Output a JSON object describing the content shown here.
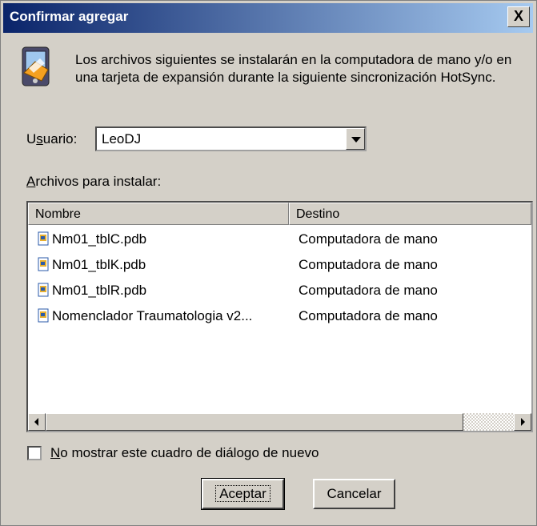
{
  "window": {
    "title": "Confirmar agregar",
    "close_glyph": "X"
  },
  "message": "Los archivos siguientes se instalarán en la computadora de mano y/o en una tarjeta de expansión durante la siguiente sincronización HotSync.",
  "user": {
    "label_prefix": "U",
    "label_accel": "s",
    "label_suffix": "uario:",
    "value": "LeoDJ"
  },
  "files_label": {
    "accel": "A",
    "rest": "rchivos para instalar:"
  },
  "list": {
    "columns": [
      "Nombre",
      "Destino"
    ],
    "rows": [
      {
        "name": "Nm01_tblC.pdb",
        "dest": "Computadora de mano"
      },
      {
        "name": "Nm01_tblK.pdb",
        "dest": "Computadora de mano"
      },
      {
        "name": "Nm01_tblR.pdb",
        "dest": "Computadora de mano"
      },
      {
        "name": "Nomenclador Traumatologia v2...",
        "dest": "Computadora de mano"
      }
    ]
  },
  "checkbox": {
    "accel": "N",
    "rest": "o mostrar este cuadro de diálogo de nuevo",
    "checked": false
  },
  "buttons": {
    "ok": "Aceptar",
    "cancel": "Cancelar"
  },
  "icons": [
    "install-icon",
    "file-icon",
    "close-icon",
    "dropdown-arrow-icon"
  ]
}
